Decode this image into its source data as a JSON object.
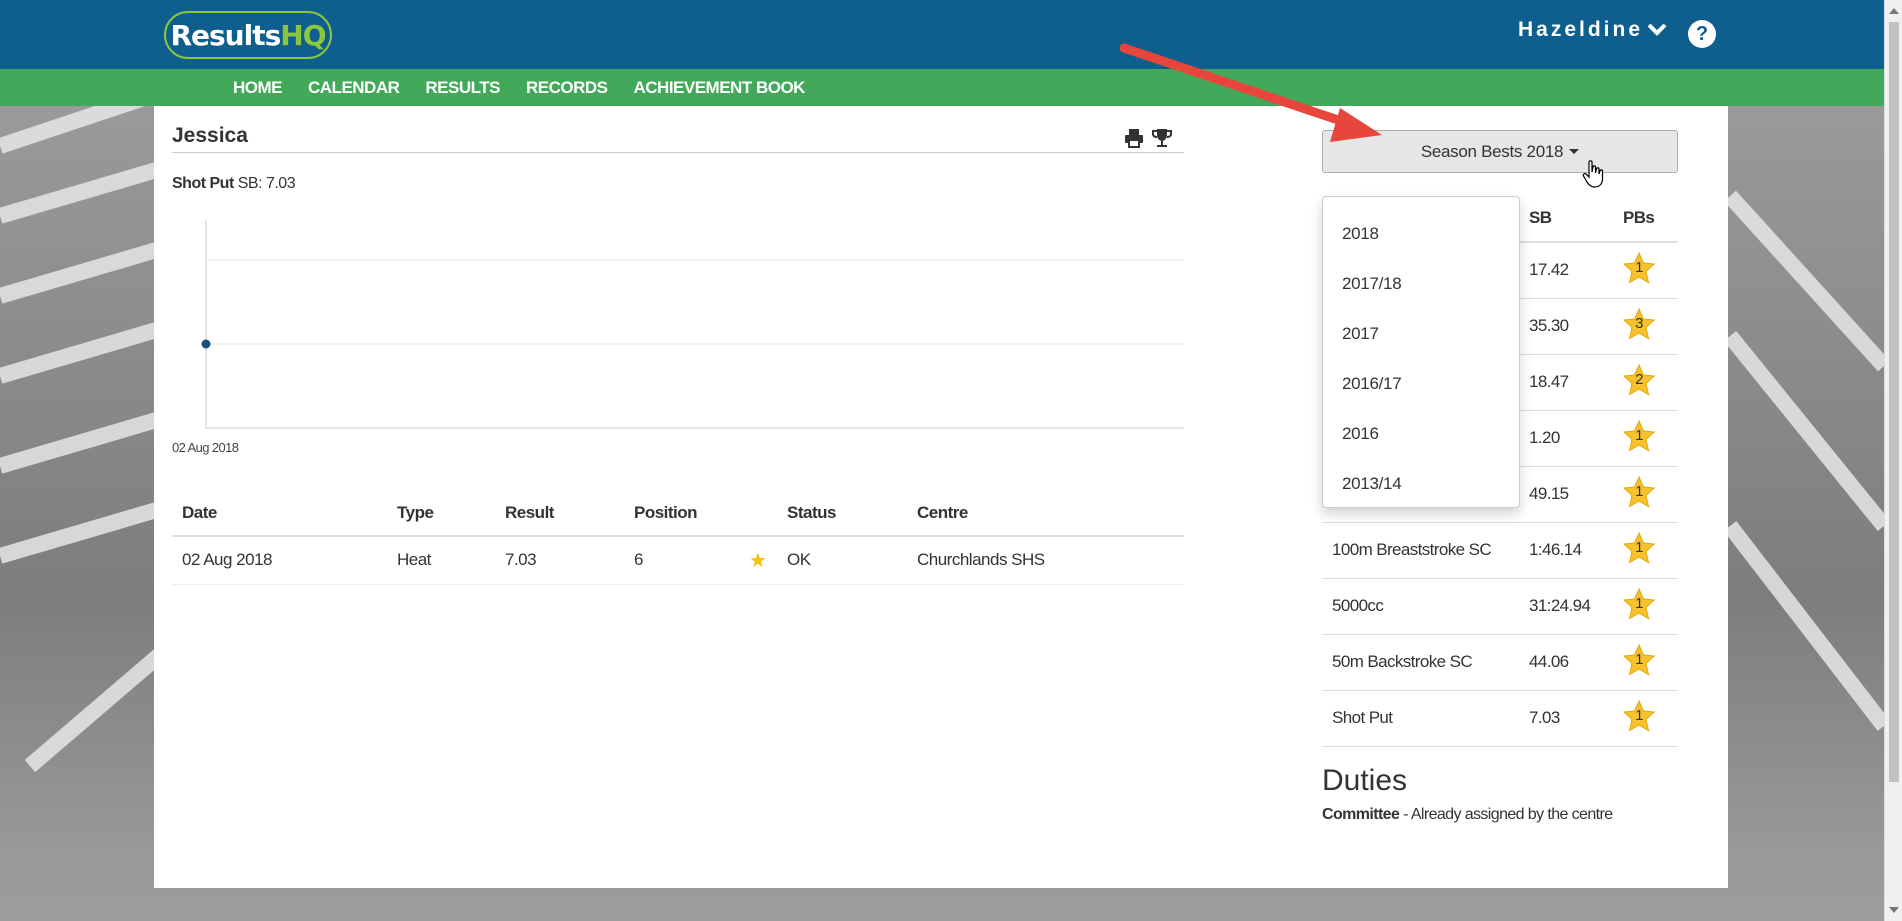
{
  "header": {
    "logo": {
      "part1": "Results",
      "part2": "HQ"
    },
    "user_name": "Hazeldine",
    "help_label": "?",
    "colors": {
      "header": "#0e5f8e",
      "nav": "#43a95a",
      "logo_accent": "#8cc63f"
    }
  },
  "nav": {
    "items": [
      "HOME",
      "CALENDAR",
      "RESULTS",
      "RECORDS",
      "ACHIEVEMENT BOOK"
    ]
  },
  "athlete": {
    "name": "Jessica",
    "event_name": "Shot Put",
    "event_sb": "SB: 7.03"
  },
  "chart_data": {
    "type": "scatter",
    "x": [
      "02 Aug 2018"
    ],
    "values": [
      7.03
    ],
    "tick_labels": [
      "02 Aug 2018"
    ],
    "grid": true
  },
  "history": {
    "headers": [
      "Date",
      "Type",
      "Result",
      "Position",
      "",
      "Status",
      "Centre"
    ],
    "rows": [
      {
        "date": "02 Aug 2018",
        "type": "Heat",
        "result": "7.03",
        "position": "6",
        "star": "★",
        "status": "OK",
        "centre": "Churchlands SHS"
      }
    ]
  },
  "season_bests": {
    "button_label": "Season Bests 2018",
    "headers": [
      "",
      "SB",
      "PBs"
    ],
    "rows": [
      {
        "event": "",
        "sb": "17.42",
        "pbs": "1"
      },
      {
        "event": "",
        "sb": "35.30",
        "pbs": "3"
      },
      {
        "event": "",
        "sb": "18.47",
        "pbs": "2"
      },
      {
        "event": "",
        "sb": "1.20",
        "pbs": "1"
      },
      {
        "event": "",
        "sb": "49.15",
        "pbs": "1"
      },
      {
        "event": "100m Breaststroke SC",
        "sb": "1:46.14",
        "pbs": "1"
      },
      {
        "event": "5000cc",
        "sb": "31:24.94",
        "pbs": "1"
      },
      {
        "event": "50m Backstroke SC",
        "sb": "44.06",
        "pbs": "1"
      },
      {
        "event": "Shot Put",
        "sb": "7.03",
        "pbs": "1"
      }
    ],
    "dropdown_options": [
      "2018",
      "2017/18",
      "2017",
      "2016/17",
      "2016",
      "2013/14"
    ]
  },
  "duties": {
    "title": "Duties",
    "role": "Committee",
    "text": " - Already assigned by the centre"
  }
}
